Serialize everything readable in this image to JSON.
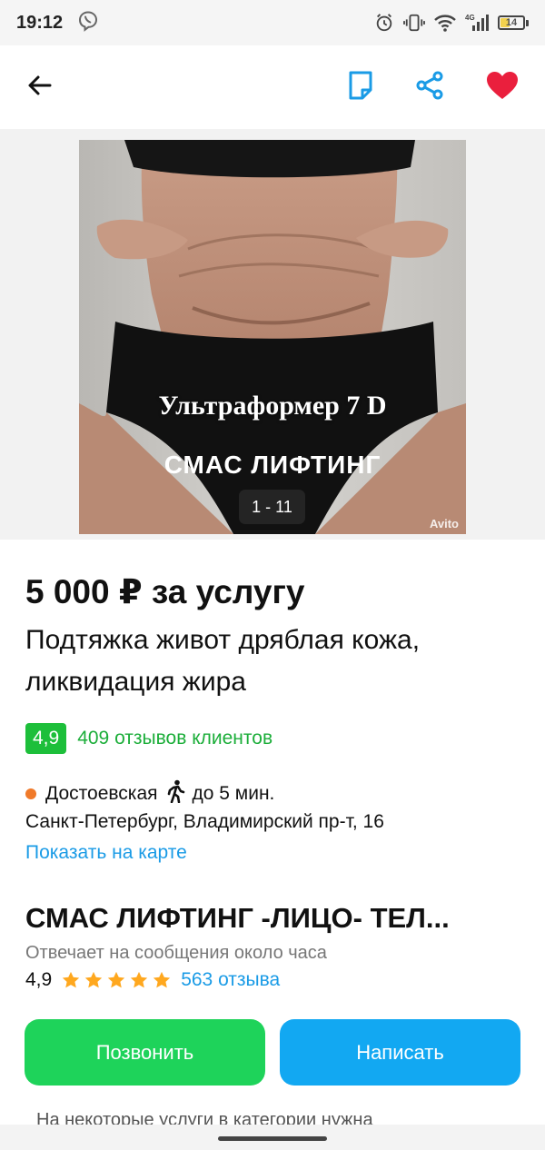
{
  "status_bar": {
    "time": "19:12",
    "battery": "14",
    "network": "4G",
    "icons": [
      "viber-icon",
      "alarm-icon",
      "vibrate-icon",
      "wifi-icon",
      "signal-icon",
      "battery-icon"
    ]
  },
  "header": {
    "back_icon": "arrow-left-icon",
    "note_icon": "note-icon",
    "share_icon": "share-icon",
    "favorite_icon": "heart-icon"
  },
  "gallery": {
    "photo_title": "Ультраформер 7 D",
    "photo_subtitle": "СМАС ЛИФТИНГ",
    "counter": "1 - 11",
    "watermark": "Avito"
  },
  "listing": {
    "price": "5 000 ₽ за услугу",
    "title": "Подтяжка живот дряблая кожа, ликвидация жира",
    "rating": "4,9",
    "reviews": "409 отзывов клиентов",
    "metro": "Достоевская",
    "walk_time": "до 5 мин.",
    "address": "Санкт-Петербург, Владимирский пр-т, 16",
    "map_link": "Показать на карте"
  },
  "seller": {
    "name": "СМАС ЛИФТИНГ -ЛИЦО- ТЕЛ...",
    "response": "Отвечает на сообщения около часа",
    "rating": "4,9",
    "stars": 5,
    "reviews": "563 отзыва"
  },
  "actions": {
    "call": "Позвонить",
    "write": "Написать"
  },
  "bottom_note": "На некоторые услуги в категории нужна",
  "colors": {
    "green": "#1ed35a",
    "blue": "#12a8f2",
    "rating_green": "#1dbf3a",
    "link_blue": "#1a9be6",
    "heart_red": "#ea1f3d",
    "star": "#ffa81f"
  }
}
